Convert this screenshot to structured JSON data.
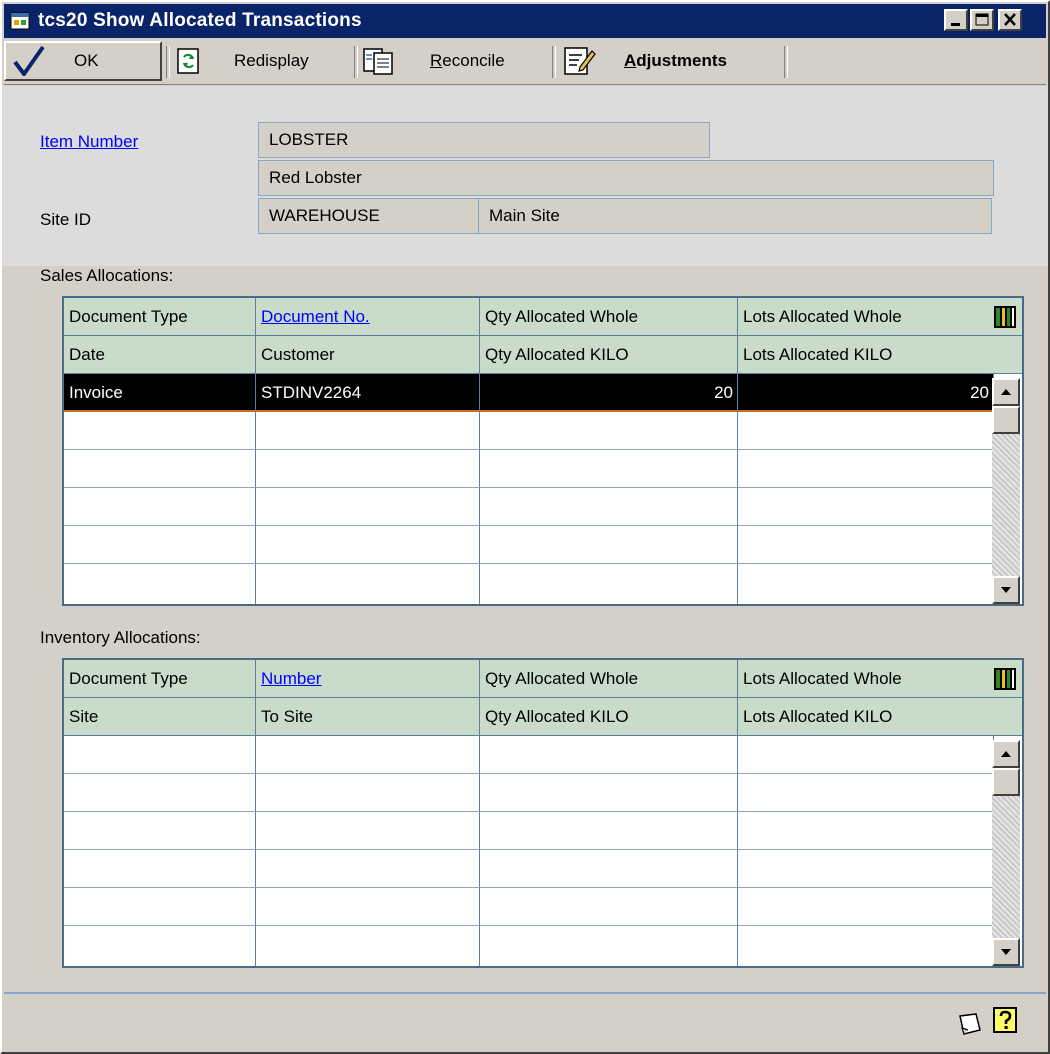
{
  "window": {
    "title": "tcs20 Show Allocated Transactions"
  },
  "toolbar": {
    "ok_label": "OK",
    "redisplay_label": "Redisplay",
    "reconcile_label": "Reconcile",
    "adjustments_label": "Adjustments"
  },
  "header": {
    "item_number_label": "Item Number",
    "item_number_value": "LOBSTER",
    "item_description": "Red Lobster",
    "site_id_label": "Site ID",
    "site_id_value": "WAREHOUSE",
    "site_description": "Main Site"
  },
  "sales": {
    "label": "Sales Allocations:",
    "headers_row1": [
      "Document Type",
      "Document No.",
      "Qty Allocated Whole",
      "Lots Allocated Whole"
    ],
    "headers_row2": [
      "Date",
      "Customer",
      "Qty Allocated KILO",
      "Lots Allocated KILO"
    ],
    "rows": [
      {
        "document_type": "Invoice",
        "document_no": "STDINV2264",
        "qty_allocated": "20",
        "lots_allocated": "20"
      }
    ]
  },
  "inventory": {
    "label": "Inventory Allocations:",
    "headers_row1": [
      "Document Type",
      "Number",
      "Qty Allocated Whole",
      "Lots Allocated Whole"
    ],
    "headers_row2": [
      "Site",
      "To Site",
      "Qty Allocated KILO",
      "Lots Allocated KILO"
    ],
    "rows": []
  },
  "colors": {
    "title_bar": "#0a246a",
    "grid_header": "#c9dcc9",
    "field_border": "#87a7c7",
    "link": "#0000ff",
    "selected_row": "#000000"
  },
  "icons": [
    "window-app-icon",
    "minimize-icon",
    "maximize-icon",
    "close-icon",
    "checkmark-icon",
    "redisplay-icon",
    "reconcile-icon",
    "adjustments-icon",
    "column-chooser-icon",
    "scroll-up-icon",
    "scroll-down-icon",
    "note-icon",
    "help-icon"
  ]
}
